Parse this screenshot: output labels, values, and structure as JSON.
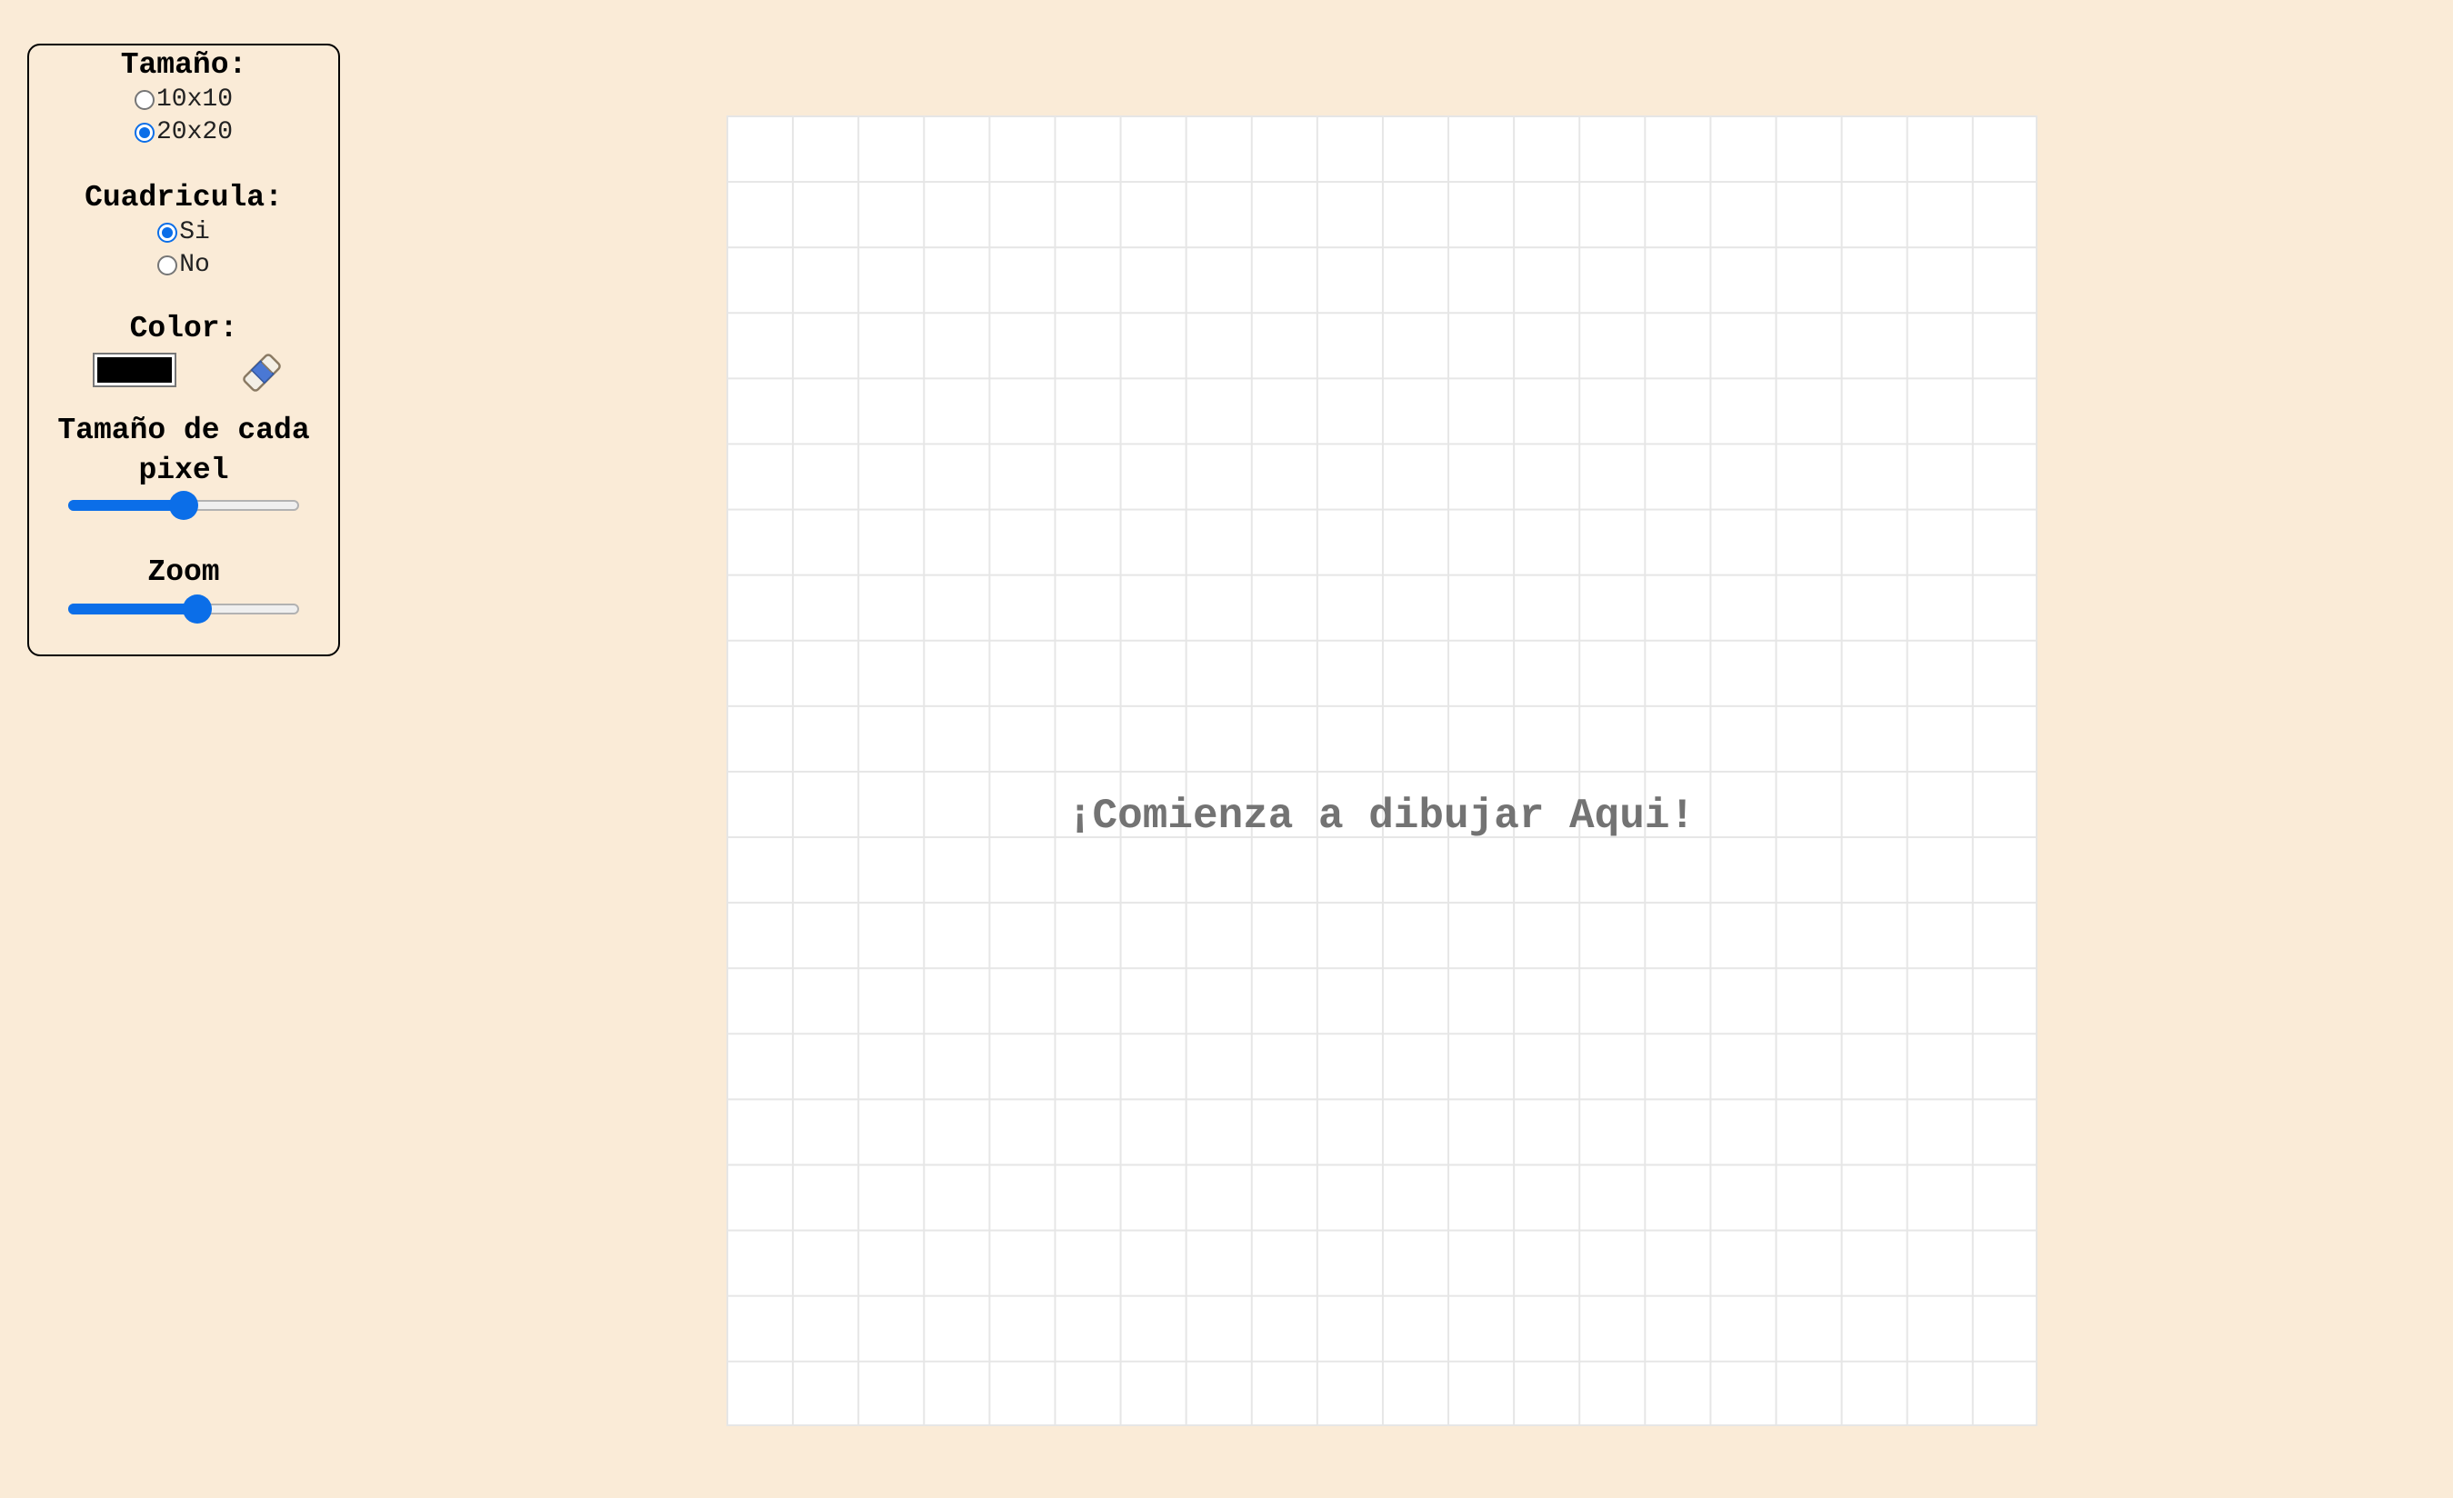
{
  "controls": {
    "size": {
      "title": "Tamaño:",
      "options": [
        {
          "label": "10x10",
          "checked": false
        },
        {
          "label": "20x20",
          "checked": true
        }
      ]
    },
    "grid": {
      "title": "Cuadricula:",
      "options": [
        {
          "label": "Si",
          "checked": true
        },
        {
          "label": "No",
          "checked": false
        }
      ]
    },
    "color": {
      "title": "Color:",
      "value": "#000000",
      "eraser_icon": "eraser-icon"
    },
    "pixel_size": {
      "title_line1": "Tamaño de cada",
      "title_line2": "pixel",
      "slider_value": 0.5
    },
    "zoom": {
      "title": "Zoom",
      "slider_value": 0.56
    }
  },
  "canvas": {
    "message": "¡Comienza a dibujar Aqui!",
    "grid_size": 20,
    "grid_visible": true
  },
  "colors": {
    "page_bg": "#faebd7",
    "accent": "#0b6ee8",
    "grid_line": "#e6e6e6",
    "message": "#737373"
  }
}
